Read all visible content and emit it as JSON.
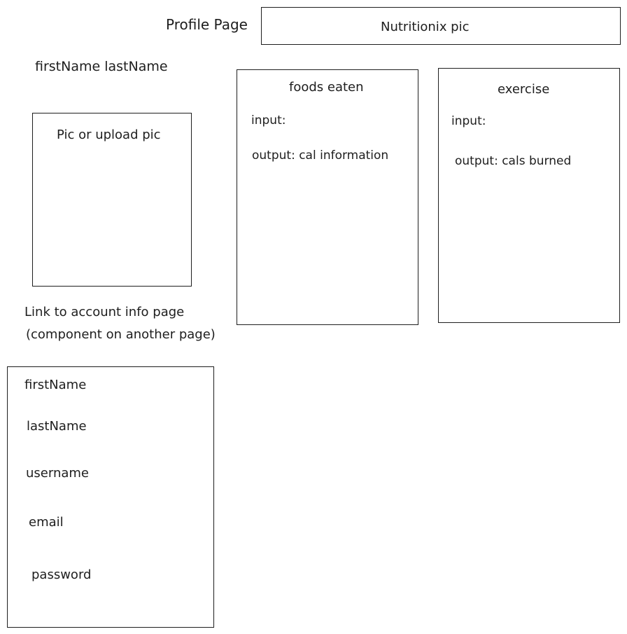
{
  "header": {
    "title": "Profile Page",
    "banner_label": "Nutritionix pic"
  },
  "profile": {
    "name_label": "firstName lastName",
    "pic_label": "Pic or upload pic",
    "link_line1": "Link to account info page",
    "link_line2": "(component on another page)"
  },
  "foods_panel": {
    "title": "foods eaten",
    "input_label": "input:",
    "output_label": "output: cal information"
  },
  "exercise_panel": {
    "title": "exercise",
    "input_label": "input:",
    "output_label": "output: cals burned"
  },
  "account_form": {
    "fields": [
      "firstName",
      "lastName",
      "username",
      "email",
      "password"
    ]
  }
}
